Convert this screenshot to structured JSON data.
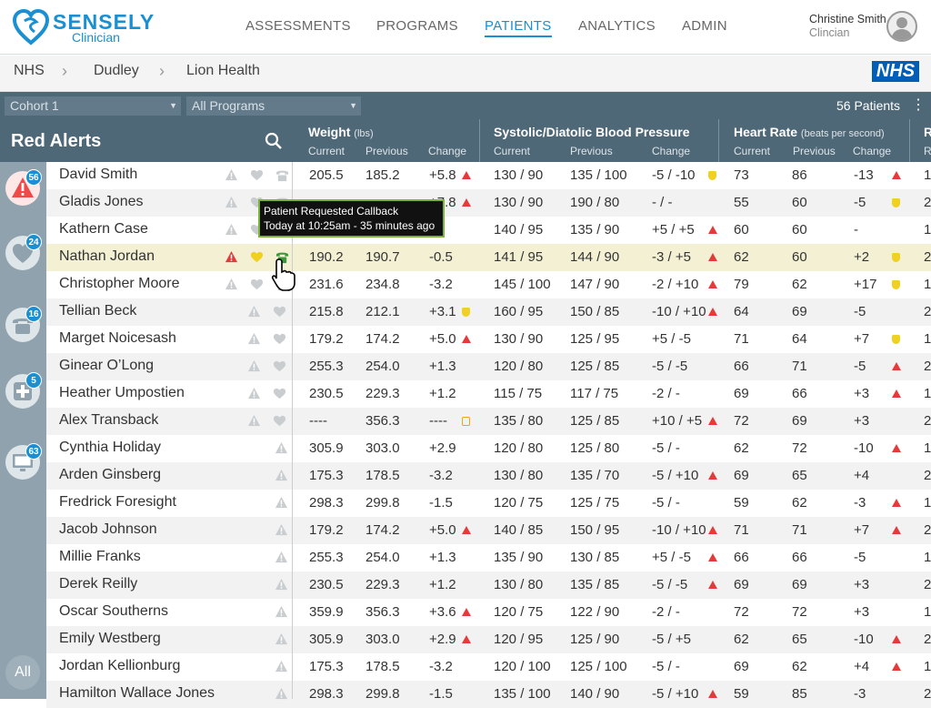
{
  "header": {
    "brand": "SENSELY",
    "brand_sub": "Clinician",
    "nav": [
      "ASSESSMENTS",
      "PROGRAMS",
      "PATIENTS",
      "ANALYTICS",
      "ADMIN"
    ],
    "active_nav": "PATIENTS",
    "user_name": "Christine Smith",
    "user_role": "Clincian"
  },
  "breadcrumb": [
    "NHS",
    "Dudley",
    "Lion Health"
  ],
  "nhs_logo": "NHS",
  "filters": {
    "cohort": "Cohort 1",
    "programs": "All Programs",
    "patients_count": "56 Patients"
  },
  "list": {
    "title": "Red Alerts"
  },
  "rail": [
    {
      "icon": "alert-icon",
      "count": "56"
    },
    {
      "icon": "heart-icon",
      "count": "24"
    },
    {
      "icon": "phone-icon",
      "count": "16"
    },
    {
      "icon": "medical-cross-icon",
      "count": "5"
    },
    {
      "icon": "monitor-icon",
      "count": "63"
    }
  ],
  "rail_all": "All",
  "columns": {
    "weight": {
      "title": "Weight",
      "unit": "(lbs)"
    },
    "bp": {
      "title": "Systolic/Diatolic Blood Pressure"
    },
    "hr": {
      "title": "Heart Rate",
      "unit": "(beats per second)"
    },
    "next": {
      "title": "R"
    },
    "sub": [
      "Current",
      "Previous",
      "Change"
    ]
  },
  "tooltip": {
    "line1": "Patient Requested Callback",
    "line2": "Today at 10:25am - 35 minutes ago"
  },
  "colors": {
    "accent": "#1a8fd1",
    "alert_red": "#e53a3a",
    "alert_yellow": "#f0d020",
    "header_bg": "#4f6878"
  },
  "patients": [
    {
      "name": "David Smith",
      "w": [
        "205.5",
        "185.2",
        "+5.8"
      ],
      "wi": "red",
      "bp": [
        "130 / 90",
        "135 / 100",
        "-5 / -10"
      ],
      "bpi": "yellow",
      "hr": [
        "73",
        "86",
        "-13"
      ],
      "hri": "red",
      "r": "1"
    },
    {
      "name": "Gladis Jones",
      "w": [
        "",
        "",
        "+7.8"
      ],
      "wi": "red",
      "bp": [
        "130 / 90",
        "190 / 80",
        " - / -"
      ],
      "bpi": "",
      "hr": [
        "55",
        "60",
        "-5"
      ],
      "hri": "yellow",
      "r": "2"
    },
    {
      "name": "Kathern Case",
      "w": [
        "",
        "",
        "1"
      ],
      "wi": "",
      "bp": [
        "140 / 95",
        "135 / 90",
        "+5 / +5"
      ],
      "bpi": "red",
      "hr": [
        "60",
        "60",
        "-"
      ],
      "hri": "",
      "r": "1"
    },
    {
      "name": "Nathan Jordan",
      "w": [
        "190.2",
        "190.7",
        "-0.5"
      ],
      "wi": "",
      "bp": [
        "141 / 95",
        "144 / 90",
        "-3 / +5"
      ],
      "bpi": "red",
      "hr": [
        "62",
        "60",
        "+2"
      ],
      "hri": "yellow",
      "r": "2"
    },
    {
      "name": "Christopher Moore",
      "w": [
        "231.6",
        "234.8",
        "-3.2"
      ],
      "wi": "",
      "bp": [
        "145 / 100",
        "147 / 90",
        "-2 / +10"
      ],
      "bpi": "red",
      "hr": [
        "79",
        "62",
        "+17"
      ],
      "hri": "yellow",
      "r": "1"
    },
    {
      "name": "Tellian Beck",
      "w": [
        "215.8",
        "212.1",
        "+3.1"
      ],
      "wi": "yellow",
      "bp": [
        "160 / 95",
        "150 / 85",
        "-10 / +10"
      ],
      "bpi": "red",
      "hr": [
        "64",
        "69",
        "-5"
      ],
      "hri": "",
      "r": "2"
    },
    {
      "name": "Marget Noicesash",
      "w": [
        "179.2",
        "174.2",
        "+5.0"
      ],
      "wi": "red",
      "bp": [
        "130 / 90",
        "125 / 95",
        "+5 / -5"
      ],
      "bpi": "",
      "hr": [
        "71",
        "64",
        "+7"
      ],
      "hri": "yellow",
      "r": "1"
    },
    {
      "name": "Ginear O’Long",
      "w": [
        "255.3",
        "254.0",
        "+1.3"
      ],
      "wi": "",
      "bp": [
        "120 / 80",
        "125 / 85",
        "-5 / -5"
      ],
      "bpi": "",
      "hr": [
        "66",
        "71",
        "-5"
      ],
      "hri": "red",
      "r": "2"
    },
    {
      "name": "Heather Umpostien",
      "w": [
        "230.5",
        "229.3",
        "+1.2"
      ],
      "wi": "",
      "bp": [
        "115 / 75",
        "117 / 75",
        "-2 / -"
      ],
      "bpi": "",
      "hr": [
        "69",
        "66",
        "+3"
      ],
      "hri": "red",
      "r": "1"
    },
    {
      "name": "Alex Transback",
      "w": [
        "----",
        "356.3",
        "----"
      ],
      "wi": "orange",
      "bp": [
        "135 / 80",
        "125 / 85",
        "+10 / +5"
      ],
      "bpi": "red",
      "hr": [
        "72",
        "69",
        "+3"
      ],
      "hri": "",
      "r": "2"
    },
    {
      "name": "Cynthia Holiday",
      "w": [
        "305.9",
        "303.0",
        "+2.9"
      ],
      "wi": "",
      "bp": [
        "120 / 80",
        "125 / 80",
        "-5 / -"
      ],
      "bpi": "",
      "hr": [
        "62",
        "72",
        "-10"
      ],
      "hri": "red",
      "r": "1"
    },
    {
      "name": "Arden Ginsberg",
      "w": [
        "175.3",
        "178.5",
        "-3.2"
      ],
      "wi": "",
      "bp": [
        "130 / 80",
        "135 / 70",
        "-5 / +10"
      ],
      "bpi": "red",
      "hr": [
        "69",
        "65",
        "+4"
      ],
      "hri": "",
      "r": "2"
    },
    {
      "name": "Fredrick Foresight",
      "w": [
        "298.3",
        "299.8",
        "-1.5"
      ],
      "wi": "",
      "bp": [
        "120 / 75",
        "125 / 75",
        "-5 / -"
      ],
      "bpi": "",
      "hr": [
        "59",
        "62",
        "-3"
      ],
      "hri": "red",
      "r": "1"
    },
    {
      "name": "Jacob Johnson",
      "w": [
        "179.2",
        "174.2",
        "+5.0"
      ],
      "wi": "red",
      "bp": [
        "140 / 85",
        "150 / 95",
        "-10 / +10"
      ],
      "bpi": "red",
      "hr": [
        "71",
        "71",
        "+7"
      ],
      "hri": "red",
      "r": "2"
    },
    {
      "name": "Millie Franks",
      "w": [
        "255.3",
        "254.0",
        "+1.3"
      ],
      "wi": "",
      "bp": [
        "135 / 90",
        "130 / 85",
        "+5 / -5"
      ],
      "bpi": "red",
      "hr": [
        "66",
        "66",
        "-5"
      ],
      "hri": "",
      "r": "1"
    },
    {
      "name": "Derek Reilly",
      "w": [
        "230.5",
        "229.3",
        "+1.2"
      ],
      "wi": "",
      "bp": [
        "130 / 80",
        "135 / 85",
        "-5 / -5"
      ],
      "bpi": "red",
      "hr": [
        "69",
        "69",
        "+3"
      ],
      "hri": "",
      "r": "2"
    },
    {
      "name": "Oscar Southerns",
      "w": [
        "359.9",
        "356.3",
        "+3.6"
      ],
      "wi": "red",
      "bp": [
        "120 / 75",
        "122 / 90",
        "-2 / -"
      ],
      "bpi": "",
      "hr": [
        "72",
        "72",
        "+3"
      ],
      "hri": "",
      "r": "1"
    },
    {
      "name": "Emily Westberg",
      "w": [
        "305.9",
        "303.0",
        "+2.9"
      ],
      "wi": "red",
      "bp": [
        "120 / 95",
        "125 / 90",
        "-5 / +5"
      ],
      "bpi": "",
      "hr": [
        "62",
        "65",
        "-10"
      ],
      "hri": "red",
      "r": "2"
    },
    {
      "name": "Jordan Kellionburg",
      "w": [
        "175.3",
        "178.5",
        "-3.2"
      ],
      "wi": "",
      "bp": [
        "120 / 100",
        "125 / 100",
        "-5 / -"
      ],
      "bpi": "",
      "hr": [
        "69",
        "62",
        "+4"
      ],
      "hri": "red",
      "r": "1"
    },
    {
      "name": "Hamilton Wallace Jones",
      "w": [
        "298.3",
        "299.8",
        "-1.5"
      ],
      "wi": "",
      "bp": [
        "135 / 100",
        "140 / 90",
        "-5 / +10"
      ],
      "bpi": "red",
      "hr": [
        "59",
        "85",
        "-3"
      ],
      "hri": "",
      "r": "2"
    }
  ]
}
